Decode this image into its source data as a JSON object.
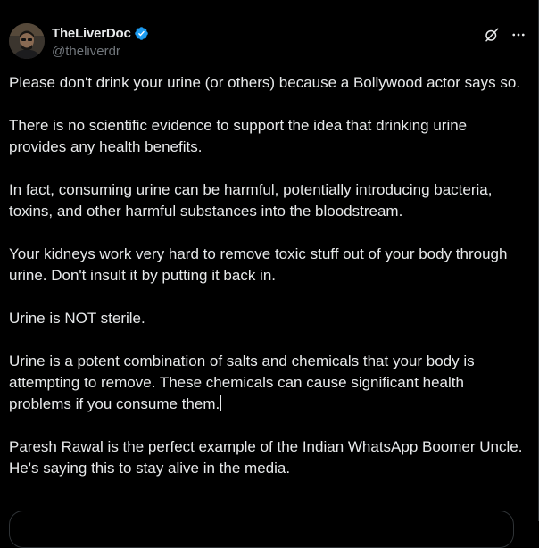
{
  "author": {
    "display_name": "TheLiverDoc",
    "handle": "@theliverdr",
    "verified": true,
    "avatar_icon": "profile-photo"
  },
  "header_actions": [
    {
      "icon": "grok-icon"
    },
    {
      "icon": "more-icon"
    }
  ],
  "tweet": {
    "paragraphs": [
      "Please don't drink your urine (or others) because a Bollywood actor says so.",
      "There is no scientific evidence to support the idea that drinking urine provides any health benefits.",
      "In fact, consuming urine can be harmful, potentially introducing bacteria, toxins, and other harmful substances into the bloodstream.",
      "Your kidneys work very hard to remove toxic stuff out of your body through urine. Don't insult it by putting it back in.",
      "Urine is NOT sterile.",
      "Urine is a potent combination of salts and chemicals that your body is attempting to remove. These chemicals can cause significant health problems if you consume them.",
      "Paresh Rawal is the perfect example of the Indian WhatsApp Boomer Uncle. He's saying this to stay alive in the media."
    ]
  },
  "colors": {
    "background": "#000000",
    "text_primary": "#e7e9ea",
    "text_secondary": "#71767b",
    "verified_blue": "#1d9bf0",
    "border": "#2f3336"
  }
}
